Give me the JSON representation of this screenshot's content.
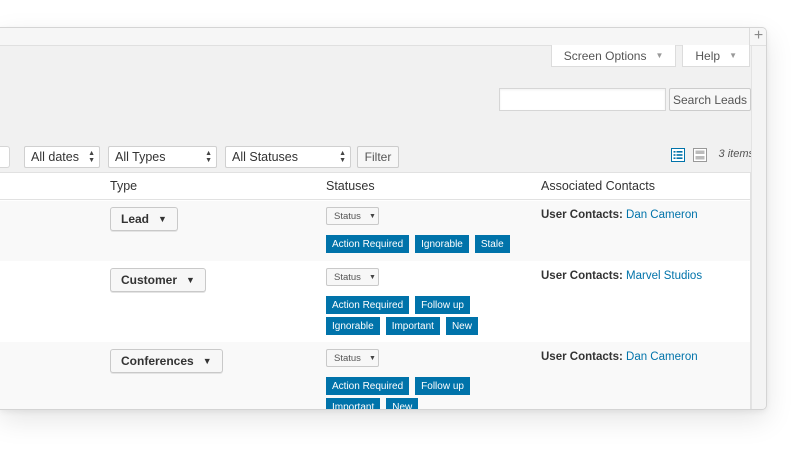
{
  "header": {
    "screen_options_label": "Screen Options",
    "help_label": "Help",
    "plus": "+"
  },
  "search": {
    "placeholder": "",
    "button_label": "Search Leads"
  },
  "filters": {
    "dates": "All dates",
    "types": "All Types",
    "statuses": "All Statuses",
    "filter_button": "Filter"
  },
  "view_modes": [
    "list-view-icon",
    "excerpt-view-icon"
  ],
  "items_count": "3 items",
  "table": {
    "columns": [
      "Type",
      "Statuses",
      "Associated Contacts"
    ],
    "status_select_label": "Status",
    "rows": [
      {
        "type": "Lead",
        "statuses": [
          "Action Required",
          "Ignorable",
          "Stale"
        ],
        "contact_label": "User Contacts:",
        "contact_name": "Dan Cameron"
      },
      {
        "type": "Customer",
        "statuses": [
          "Action Required",
          "Follow up",
          "Ignorable",
          "Important",
          "New"
        ],
        "contact_label": "User Contacts:",
        "contact_name": "Marvel Studios"
      },
      {
        "type": "Conferences",
        "statuses": [
          "Action Required",
          "Follow up",
          "Important",
          "New"
        ],
        "contact_label": "User Contacts:",
        "contact_name": "Dan Cameron"
      }
    ]
  },
  "colors": {
    "accent": "#0073aa",
    "background": "#f1f1f1"
  }
}
